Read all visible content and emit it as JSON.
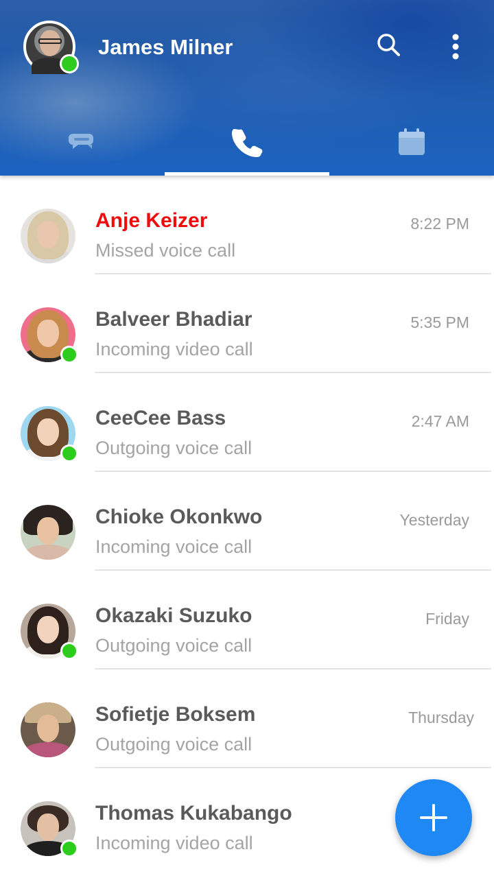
{
  "header": {
    "user_name": "James Milner",
    "user_online": true,
    "icons": {
      "search": "search-icon",
      "menu": "more-vert-icon"
    },
    "tabs": [
      {
        "icon": "chat-bubbles-icon",
        "active": false
      },
      {
        "icon": "phone-icon",
        "active": true
      },
      {
        "icon": "calendar-icon",
        "active": false
      }
    ]
  },
  "calls": [
    {
      "name": "Anje Keizer",
      "detail": "Missed voice call",
      "time": "8:22 PM",
      "missed": true,
      "online": false
    },
    {
      "name": "Balveer Bhadiar",
      "detail": "Incoming video call",
      "time": "5:35 PM",
      "missed": false,
      "online": true
    },
    {
      "name": "CeeCee Bass",
      "detail": "Outgoing voice call",
      "time": "2:47 AM",
      "missed": false,
      "online": true
    },
    {
      "name": "Chioke Okonkwo",
      "detail": "Incoming voice call",
      "time": "Yesterday",
      "missed": false,
      "online": false
    },
    {
      "name": "Okazaki Suzuko",
      "detail": "Outgoing voice call",
      "time": "Friday",
      "missed": false,
      "online": true
    },
    {
      "name": "Sofietje Boksem",
      "detail": "Outgoing voice call",
      "time": "Thursday",
      "missed": false,
      "online": false
    },
    {
      "name": "Thomas Kukabango",
      "detail": "Incoming video call",
      "time": "",
      "missed": false,
      "online": true
    }
  ],
  "fab": {
    "icon": "plus-icon"
  },
  "colors": {
    "header_blue": "#1f5aaa",
    "missed_red": "#ee0d0d",
    "online_green": "#2ecc1e",
    "fab_blue": "#1e88f5",
    "tab_icon_inactive": "#8fb6e0"
  }
}
